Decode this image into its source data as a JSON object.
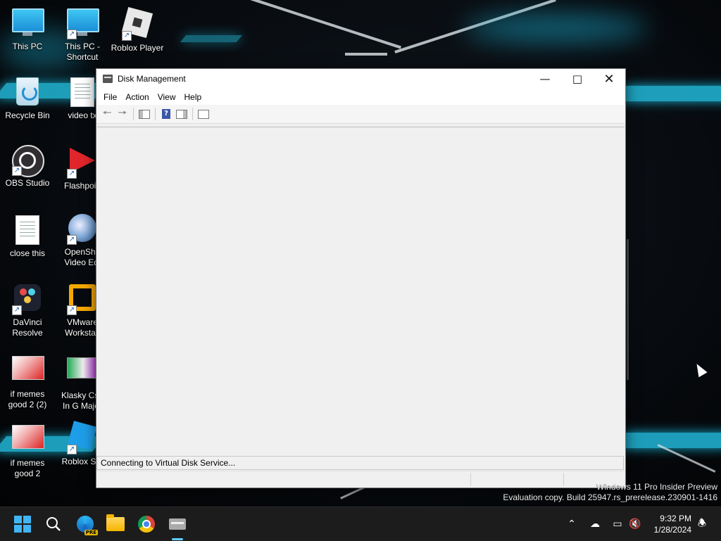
{
  "desktop": {
    "icons": [
      {
        "label": "This PC"
      },
      {
        "label": "This PC -\nShortcut"
      },
      {
        "label": "Roblox Player"
      },
      {
        "label": "Recycle Bin"
      },
      {
        "label": "video tx"
      },
      {
        "label": "OBS Studio"
      },
      {
        "label": "Flashpoin"
      },
      {
        "label": "close this"
      },
      {
        "label": "OpenSho\nVideo Edi"
      },
      {
        "label": "DaVinci\nResolve"
      },
      {
        "label": "VMware\nWorkstati"
      },
      {
        "label": "if memes\ngood 2 (2)"
      },
      {
        "label": "Klasky Csu\nIn G Major"
      },
      {
        "label": "if memes\ngood 2"
      },
      {
        "label": "Roblox Stu"
      }
    ],
    "watermark": {
      "line1": "Windows 11 Pro Insider Preview",
      "line2": "Evaluation copy. Build 25947.rs_prerelease.230901-1416"
    }
  },
  "window": {
    "title": "Disk Management",
    "menu": {
      "file": "File",
      "action": "Action",
      "view": "View",
      "help": "Help"
    },
    "status": "Connecting to Virtual Disk Service..."
  },
  "taskbar": {
    "clock_time": "9:32 PM",
    "clock_date": "1/28/2024",
    "pinned": [
      "start-icon",
      "search-icon",
      "edge-beta-icon",
      "file-explorer-icon",
      "chrome-icon",
      "disk-management-icon"
    ]
  },
  "colors": {
    "accent": "#22b8d8",
    "taskbar": "#1c1c1c",
    "window_bg": "#f0f0f0"
  }
}
